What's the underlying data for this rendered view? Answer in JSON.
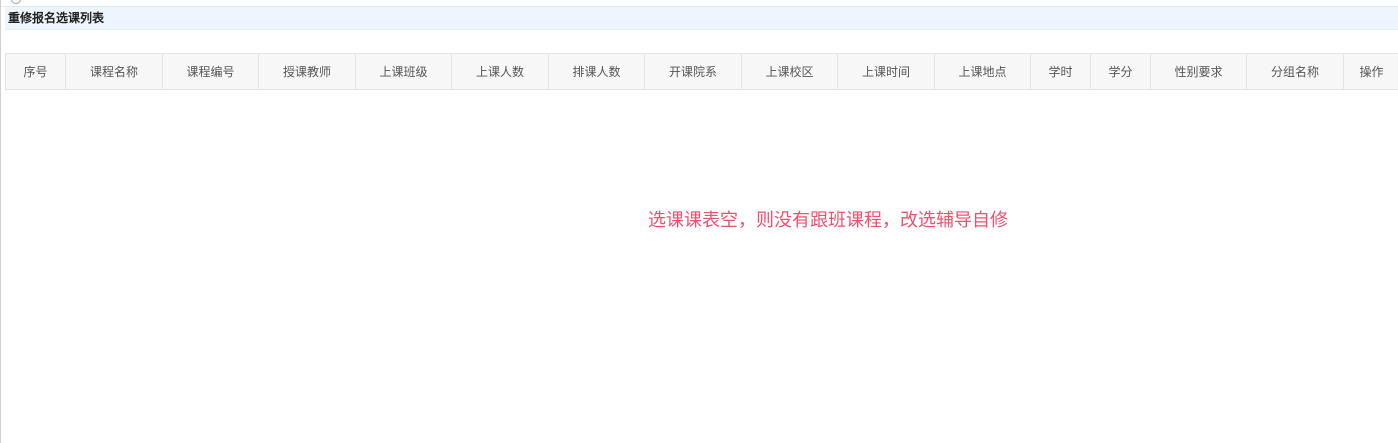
{
  "panel": {
    "title": "重修报名选课列表"
  },
  "table": {
    "columns": [
      {
        "label": "序号"
      },
      {
        "label": "课程名称"
      },
      {
        "label": "课程编号"
      },
      {
        "label": "授课教师"
      },
      {
        "label": "上课班级"
      },
      {
        "label": "上课人数"
      },
      {
        "label": "排课人数"
      },
      {
        "label": "开课院系"
      },
      {
        "label": "上课校区"
      },
      {
        "label": "上课时间"
      },
      {
        "label": "上课地点"
      },
      {
        "label": "学时"
      },
      {
        "label": "学分"
      },
      {
        "label": "性别要求"
      },
      {
        "label": "分组名称"
      },
      {
        "label": "操作"
      }
    ],
    "empty_message": "选课课表空，则没有跟班课程，改选辅导自修"
  },
  "colors": {
    "header_bg": "#eef6fd",
    "table_header_bg": "#f7f7f7",
    "empty_message": "#f0506e"
  }
}
